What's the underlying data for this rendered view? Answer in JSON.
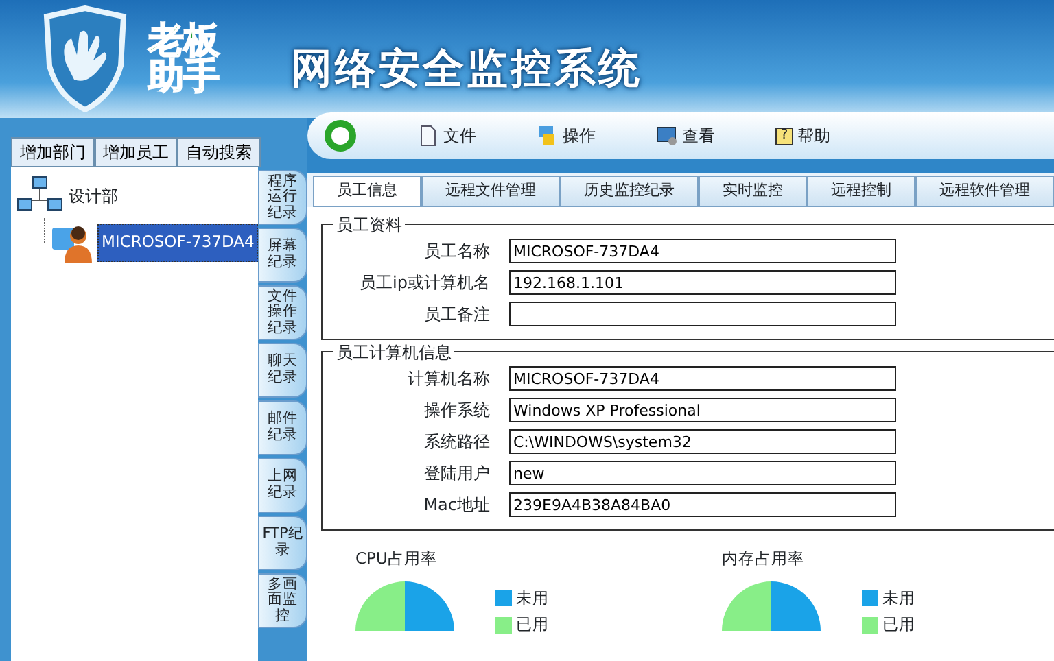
{
  "app": {
    "brand": "老板助手",
    "title": "网络安全监控系统"
  },
  "menu": [
    {
      "label": "文件",
      "kind": "file"
    },
    {
      "label": "操作",
      "kind": "action"
    },
    {
      "label": "查看",
      "kind": "view"
    },
    {
      "label": "帮助",
      "kind": "help",
      "icon": "?"
    }
  ],
  "toolbar": [
    "增加部门",
    "增加员工",
    "自动搜索"
  ],
  "tree": [
    {
      "label": "设计部",
      "selected": false,
      "children": [
        {
          "label": "MICROSOF-737DA4",
          "selected": true
        }
      ]
    }
  ],
  "side_tabs": [
    {
      "label": "程序运行纪录",
      "selected": false
    },
    {
      "label": "屏幕纪录",
      "selected": false
    },
    {
      "label": "文件操作纪录",
      "selected": false
    },
    {
      "label": "聊天纪录",
      "selected": false
    },
    {
      "label": "邮件纪录",
      "selected": false
    },
    {
      "label": "上网纪录",
      "selected": false
    },
    {
      "label": "FTP纪录",
      "selected": false
    },
    {
      "label": "多画面监控",
      "selected": false
    }
  ],
  "tabs": [
    {
      "label": "员工信息",
      "selected": true
    },
    {
      "label": "远程文件管理",
      "selected": false
    },
    {
      "label": "历史监控纪录",
      "selected": false
    },
    {
      "label": "实时监控",
      "selected": false
    },
    {
      "label": "远程控制",
      "selected": false
    },
    {
      "label": "远程软件管理",
      "selected": false
    }
  ],
  "groups": [
    {
      "title": "员工资料",
      "fields": [
        {
          "label": "员工名称",
          "value": "MICROSOF-737DA4"
        },
        {
          "label": "员工ip或计算机名",
          "value": "192.168.1.101"
        },
        {
          "label": "员工备注"
        }
      ]
    },
    {
      "title": "员工计算机信息",
      "fields": [
        {
          "label": "计算机名称",
          "value": "MICROSOF-737DA4"
        },
        {
          "label": "操作系统",
          "value": "Windows XP Professional"
        },
        {
          "label": "系统路径",
          "value": "C:\\WINDOWS\\system32"
        },
        {
          "label": "登陆用户",
          "value": "new"
        },
        {
          "label": "Mac地址",
          "value": "239E9A4B38A84BA0"
        }
      ]
    }
  ],
  "charts": [
    {
      "title": "CPU占用率",
      "legend": [
        {
          "label": "未用",
          "color": "#1aa3e8"
        },
        {
          "label": "已用",
          "color": "#88ee88"
        }
      ]
    },
    {
      "title": "内存占用率",
      "legend": [
        {
          "label": "未用",
          "color": "#1aa3e8"
        },
        {
          "label": "已用",
          "color": "#88ee88"
        }
      ]
    }
  ]
}
